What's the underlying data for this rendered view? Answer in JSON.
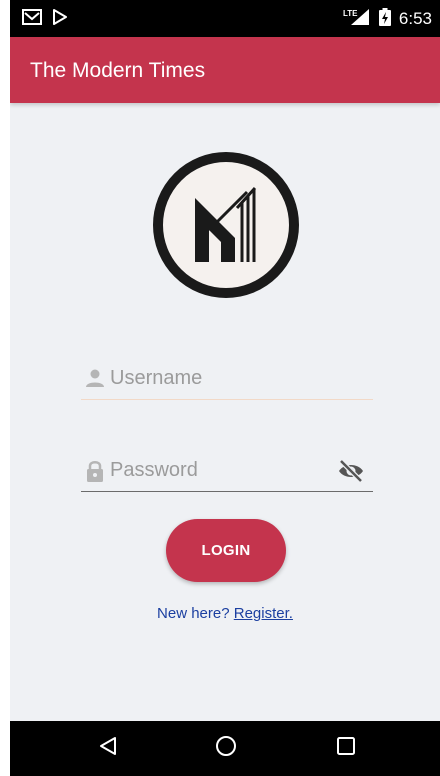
{
  "status_bar": {
    "left_icons": [
      "gmail-icon",
      "play-store-icon"
    ],
    "right_icons": [
      "lte-signal-icon",
      "battery-charging-icon"
    ],
    "network": "LTE",
    "time": "6:53"
  },
  "app_bar": {
    "title": "The Modern Times"
  },
  "logo": {
    "letter": "M"
  },
  "form": {
    "username": {
      "placeholder": "Username",
      "value": "",
      "icon": "person-icon"
    },
    "password": {
      "placeholder": "Password",
      "value": "",
      "icon": "lock-icon",
      "toggle_icon": "eye-off-icon"
    },
    "login_label": "LOGIN"
  },
  "register": {
    "prefix": "New here?",
    "link": "Register."
  },
  "nav_bar": {
    "buttons": [
      "back-icon",
      "home-icon",
      "recents-icon"
    ]
  },
  "colors": {
    "accent": "#c4344d",
    "background": "#eff1f4",
    "link": "#1b3fa0"
  }
}
